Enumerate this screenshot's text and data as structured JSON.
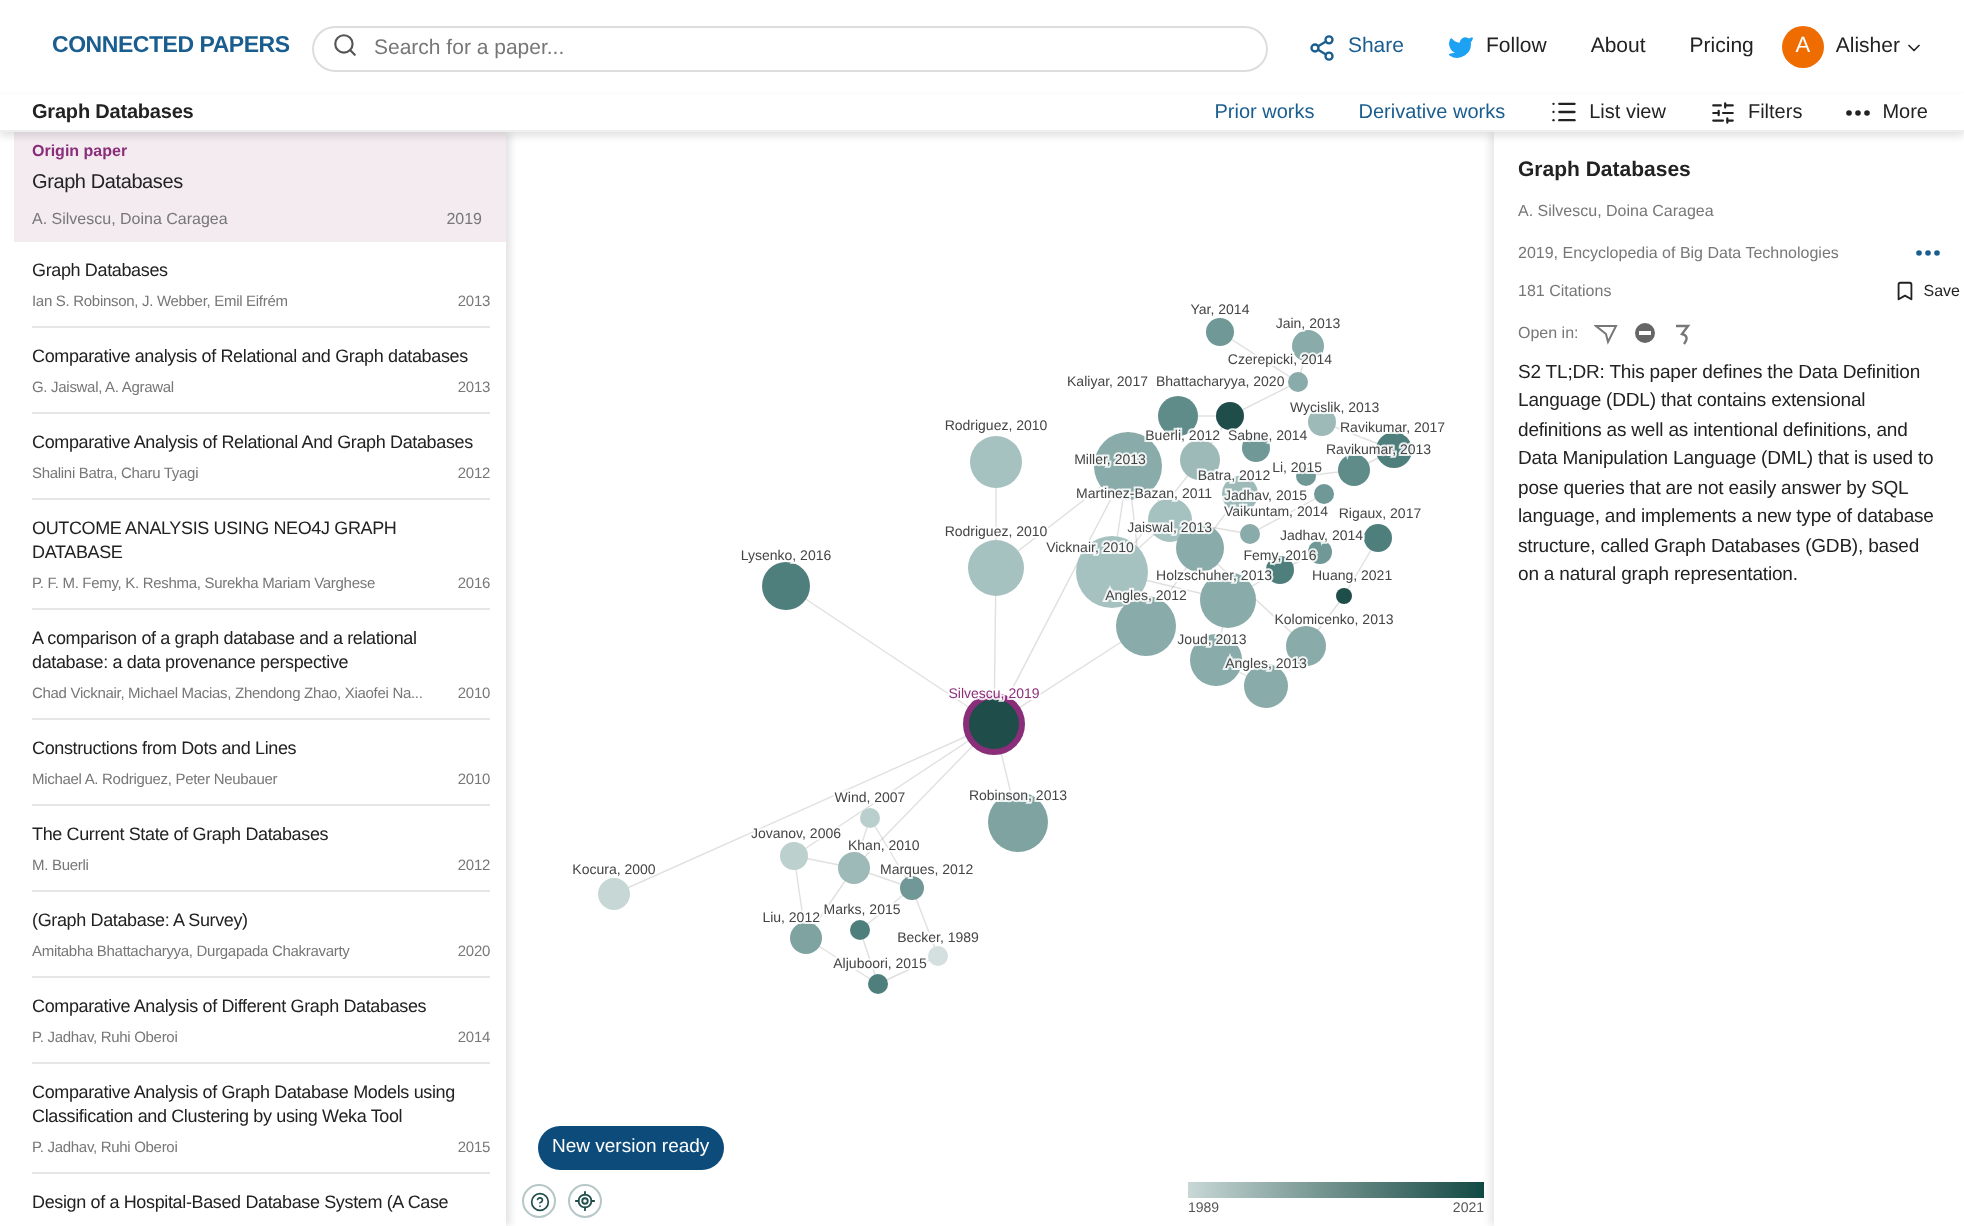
{
  "header": {
    "logo_text": "CONNECTED PAPERS",
    "search": {
      "placeholder": "Search for a paper..."
    },
    "nav": [
      {
        "kind": "share",
        "label": "Share"
      },
      {
        "kind": "follow",
        "label": "Follow"
      },
      {
        "kind": "link",
        "label": "About"
      },
      {
        "kind": "link",
        "label": "Pricing"
      }
    ],
    "user": {
      "initial": "A",
      "name": "Alisher"
    }
  },
  "toolbar": {
    "title": "Graph Databases",
    "actions": [
      {
        "kind": "link",
        "label": "Prior works"
      },
      {
        "kind": "link",
        "label": "Derivative works"
      },
      {
        "kind": "list",
        "label": "List view"
      },
      {
        "kind": "filters",
        "label": "Filters"
      },
      {
        "kind": "more",
        "label": "More"
      }
    ]
  },
  "sidebar": {
    "origin": {
      "label": "Origin paper",
      "title": "Graph Databases",
      "authors": "A. Silvescu, Doina Caragea",
      "year": "2019"
    },
    "papers": [
      {
        "title": "Graph Databases",
        "authors": "Ian S. Robinson, J. Webber, Emil Eifrém",
        "year": "2013"
      },
      {
        "title": "Comparative analysis of Relational and Graph databases",
        "authors": "G. Jaiswal, A. Agrawal",
        "year": "2013"
      },
      {
        "title": "Comparative Analysis of Relational And Graph Databases",
        "authors": "Shalini Batra, Charu Tyagi",
        "year": "2012"
      },
      {
        "title": "OUTCOME ANALYSIS USING NEO4J GRAPH DATABASE",
        "authors": "P. F. M. Femy, K. Reshma, Surekha Mariam Varghese",
        "year": "2016"
      },
      {
        "title": "A comparison of a graph database and a relational database: a data provenance perspective",
        "authors": "Chad Vicknair, Michael Macias, Zhendong Zhao, Xiaofei Na...",
        "year": "2010"
      },
      {
        "title": "Constructions from Dots and Lines",
        "authors": "Michael A. Rodriguez, Peter Neubauer",
        "year": "2010"
      },
      {
        "title": "The Current State of Graph Databases",
        "authors": "M. Buerli",
        "year": "2012"
      },
      {
        "title": "(Graph Database: A Survey)",
        "authors": "Amitabha Bhattacharyya, Durgapada Chakravarty",
        "year": "2020"
      },
      {
        "title": "Comparative Analysis of Different Graph Databases",
        "authors": "P. Jadhav, Ruhi Oberoi",
        "year": "2014"
      },
      {
        "title": "Comparative Analysis of Graph Database Models using Classification and Clustering by using Weka Tool",
        "authors": "P. Jadhav, Ruhi Oberoi",
        "year": "2015"
      },
      {
        "title": "Design of a Hospital-Based Database System (A Case"
      }
    ]
  },
  "graph": {
    "nodes": [
      {
        "kind": "origin",
        "label": "Silvescu, 2019",
        "color": "#1f4d4a"
      },
      {
        "kind": "paper",
        "label": "Wind, 2007",
        "color": "#b9cfcd"
      },
      {
        "kind": "paper",
        "label": "Robinson, 2013",
        "color": "#7fa3a1"
      },
      {
        "kind": "paper",
        "label": "Jovanov, 2006",
        "color": "#bcd0ce"
      },
      {
        "kind": "paper",
        "label": "Khan, 2010",
        "color": "#9dbab8"
      },
      {
        "kind": "paper",
        "label": "Marques, 2012",
        "color": "#6f9896"
      },
      {
        "kind": "paper",
        "label": "Marks, 2015",
        "color": "#4f7f7c"
      },
      {
        "kind": "paper",
        "label": "Liu, 2012",
        "color": "#7fa3a1"
      },
      {
        "kind": "paper",
        "label": "Becker, 1989",
        "color": "#d3e0df"
      },
      {
        "kind": "paper",
        "label": "Aljuboori, 2015",
        "color": "#4f7f7c"
      },
      {
        "kind": "paper",
        "label": "Kocura, 2000",
        "color": "#c6d7d5"
      },
      {
        "kind": "paper",
        "label": "Lysenko, 2016",
        "color": "#4f7f7c"
      },
      {
        "kind": "paper",
        "label": "Rodriguez, 2010",
        "color": "#a6c2c0"
      },
      {
        "kind": "paper",
        "label": "Rodriguez, 2010",
        "color": "#a6c2c0"
      },
      {
        "kind": "paper",
        "label": "Miller, 2013",
        "color": "#89aba9"
      },
      {
        "kind": "paper",
        "label": "Vicknair, 2010",
        "color": "#a6c2c0"
      },
      {
        "kind": "paper",
        "label": "Angles, 2012",
        "color": "#89aba9"
      },
      {
        "kind": "paper",
        "label": "Yar, 2014",
        "color": "#6f9896"
      },
      {
        "kind": "paper",
        "label": "Jain, 2013",
        "color": "#89aba9"
      },
      {
        "kind": "paper",
        "label": "Czerepicki, 2014",
        "color": "#89aba9"
      },
      {
        "kind": "paper",
        "label": "Kaliyar, 2017",
        "color": "#5f8c89"
      },
      {
        "kind": "paper",
        "label": "Bhattacharyya, 2020",
        "color": "#1f4d4a"
      },
      {
        "kind": "paper",
        "label": "Wycislik, 2013",
        "color": "#9dbab8"
      },
      {
        "kind": "paper",
        "label": "Ravikumar, 2017",
        "color": "#4f7f7c"
      },
      {
        "kind": "paper",
        "label": "Ravikumar, 2013",
        "color": "#5f8c89"
      },
      {
        "kind": "paper",
        "label": "Buerli, 2012",
        "color": "#9dbab8"
      },
      {
        "kind": "paper",
        "label": "Sabne, 2014",
        "color": "#6f9896"
      },
      {
        "kind": "paper",
        "label": "Li, 2015",
        "color": "#6f9896"
      },
      {
        "kind": "paper",
        "label": "Batra, 2012",
        "color": "#9dbab8"
      },
      {
        "kind": "paper",
        "label": "Martinez-Bazan, 2011",
        "color": "#a6c2c0"
      },
      {
        "kind": "paper",
        "label": "Jadhav, 2015",
        "color": "#6f9896"
      },
      {
        "kind": "paper",
        "label": "Vaikuntam, 2014",
        "color": "#89aba9"
      },
      {
        "kind": "paper",
        "label": "Jaiswal, 2013",
        "color": "#89aba9"
      },
      {
        "kind": "paper",
        "label": "Jadhav, 2014",
        "color": "#6f9896"
      },
      {
        "kind": "paper",
        "label": "Rigaux, 2017",
        "color": "#4f7f7c"
      },
      {
        "kind": "paper",
        "label": "Femy, 2016",
        "color": "#4f7f7c"
      },
      {
        "kind": "paper",
        "label": "Huang, 2021",
        "color": "#1f4d4a"
      },
      {
        "kind": "paper",
        "label": "Holzschuher, 2013",
        "color": "#89aba9"
      },
      {
        "kind": "paper",
        "label": "Kolomicenko, 2013",
        "color": "#89aba9"
      },
      {
        "kind": "paper",
        "label": "Joud, 2013",
        "color": "#89aba9"
      },
      {
        "kind": "paper",
        "label": "Angles, 2013",
        "color": "#89aba9"
      }
    ],
    "notice": "New version ready",
    "legend": {
      "min": "1989",
      "max": "2021"
    }
  },
  "details": {
    "title": "Graph Databases",
    "authors": "A. Silvescu, Doina Caragea",
    "venue": "2019, Encyclopedia of Big Data Technologies",
    "citations": "181 Citations",
    "save": "Save",
    "open_in": "Open in:",
    "tldr": "S2 TL;DR: This paper defines the Data Definition Language (DDL) that contains extensional definitions as well as intentional definitions, and Data Manipulation Language (DML) that is used to pose queries that are not easily answer by SQL language, and implements a new type of database structure, called Graph Databases (GDB), based on a natural graph representation."
  }
}
